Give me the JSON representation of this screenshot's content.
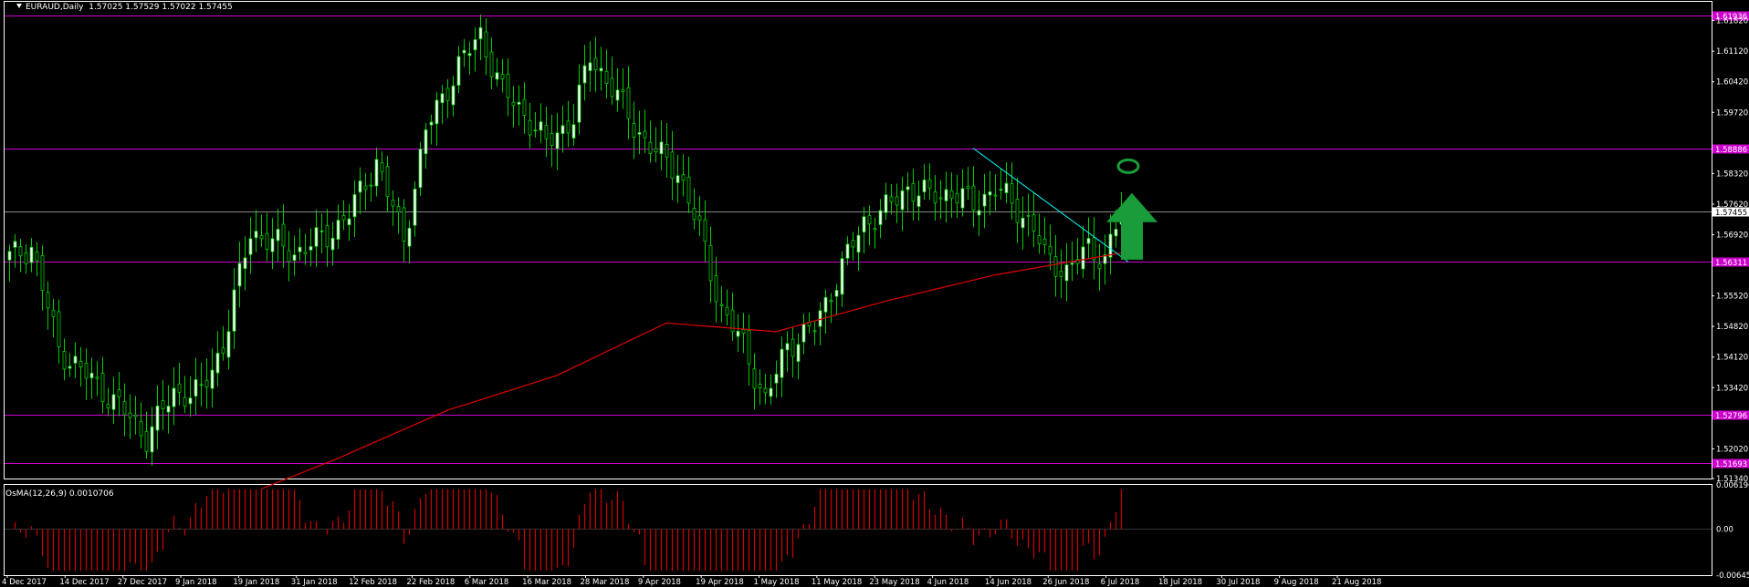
{
  "header": {
    "symbol_timeframe": "EURAUD,Daily",
    "ohlc": "1.57025 1.57529 1.57022 1.57455"
  },
  "indicator": {
    "label": "OsMA(12,26,9) 0.0010706",
    "ylim": [
      -0.00645,
      0.00619
    ],
    "tick_labels": [
      "0.006196",
      "0.00",
      "-0.006457"
    ]
  },
  "colors": {
    "background": "#000000",
    "frame": "#ffffff",
    "bull_candle": "#ffffff",
    "bear_candle": "#000000",
    "wick": "#00cc00",
    "support_resistance_lines": "#cc00cc",
    "level_label_bg": "#cc00cc",
    "moving_average": "#e00000",
    "trendline": "#00ffff",
    "current_price_line": "#8a8a8a",
    "osma_bars": "#d00000",
    "arrow": "#1a9c3a",
    "target_ellipse": "#1a9c3a"
  },
  "price_axis": {
    "ylim": [
      1.5134,
      1.6225
    ],
    "tick_labels": [
      "1.61820",
      "1.61120",
      "1.60420",
      "1.59720",
      "1.58320",
      "1.57620",
      "1.56920",
      "1.55520",
      "1.54820",
      "1.54120",
      "1.53420",
      "1.52020",
      "1.51340"
    ],
    "current_price_label": "1.57455",
    "current_price": 1.57455
  },
  "horizontal_levels": [
    {
      "label": "1.61936",
      "value": 1.61936
    },
    {
      "label": "1.58886",
      "value": 1.58886
    },
    {
      "label": "1.56311",
      "value": 1.56311
    },
    {
      "label": "1.52796",
      "value": 1.52796
    },
    {
      "label": "1.51693",
      "value": 1.51693
    }
  ],
  "time_axis": {
    "labels": [
      "4 Dec 2017",
      "14 Dec 2017",
      "27 Dec 2017",
      "9 Jan 2018",
      "19 Jan 2018",
      "31 Jan 2018",
      "12 Feb 2018",
      "22 Feb 2018",
      "6 Mar 2018",
      "16 Mar 2018",
      "28 Mar 2018",
      "9 Apr 2018",
      "19 Apr 2018",
      "1 May 2018",
      "11 May 2018",
      "23 May 2018",
      "4 Jun 2018",
      "14 Jun 2018",
      "26 Jun 2018",
      "6 Jul 2018",
      "18 Jul 2018",
      "30 Jul 2018",
      "9 Aug 2018",
      "21 Aug 2018"
    ]
  },
  "chart_data": {
    "type": "candlestick",
    "symbol": "EURAUD",
    "timeframe": "Daily",
    "ylim": [
      1.5134,
      1.6225
    ],
    "grid": false,
    "anchors": [
      {
        "i": 0,
        "close": 1.564
      },
      {
        "i": 4,
        "close": 1.5665
      },
      {
        "i": 9,
        "close": 1.543
      },
      {
        "i": 20,
        "close": 1.53
      },
      {
        "i": 25,
        "close": 1.523
      },
      {
        "i": 30,
        "close": 1.533
      },
      {
        "i": 35,
        "close": 1.533
      },
      {
        "i": 39,
        "close": 1.544
      },
      {
        "i": 44,
        "close": 1.57
      },
      {
        "i": 52,
        "close": 1.565
      },
      {
        "i": 58,
        "close": 1.569
      },
      {
        "i": 62,
        "close": 1.574
      },
      {
        "i": 67,
        "close": 1.586
      },
      {
        "i": 72,
        "close": 1.568
      },
      {
        "i": 76,
        "close": 1.593
      },
      {
        "i": 82,
        "close": 1.608
      },
      {
        "i": 86,
        "close": 1.615
      },
      {
        "i": 90,
        "close": 1.602
      },
      {
        "i": 94,
        "close": 1.597
      },
      {
        "i": 98,
        "close": 1.59
      },
      {
        "i": 103,
        "close": 1.596
      },
      {
        "i": 106,
        "close": 1.61
      },
      {
        "i": 110,
        "close": 1.603
      },
      {
        "i": 114,
        "close": 1.594
      },
      {
        "i": 118,
        "close": 1.588
      },
      {
        "i": 122,
        "close": 1.584
      },
      {
        "i": 126,
        "close": 1.57
      },
      {
        "i": 130,
        "close": 1.552
      },
      {
        "i": 134,
        "close": 1.544
      },
      {
        "i": 138,
        "close": 1.531
      },
      {
        "i": 142,
        "close": 1.544
      },
      {
        "i": 147,
        "close": 1.548
      },
      {
        "i": 152,
        "close": 1.562
      },
      {
        "i": 156,
        "close": 1.572
      },
      {
        "i": 160,
        "close": 1.575
      },
      {
        "i": 164,
        "close": 1.58
      },
      {
        "i": 168,
        "close": 1.578
      },
      {
        "i": 172,
        "close": 1.579
      },
      {
        "i": 176,
        "close": 1.576
      },
      {
        "i": 180,
        "close": 1.58
      },
      {
        "i": 184,
        "close": 1.575
      },
      {
        "i": 187,
        "close": 1.571
      },
      {
        "i": 189,
        "close": 1.564
      },
      {
        "i": 193,
        "close": 1.561
      },
      {
        "i": 197,
        "close": 1.566
      },
      {
        "i": 200,
        "close": 1.564
      },
      {
        "i": 203,
        "close": 1.5745
      }
    ],
    "moving_average": {
      "anchors": [
        {
          "i": 46,
          "value": 1.511
        },
        {
          "i": 60,
          "value": 1.518
        },
        {
          "i": 80,
          "value": 1.529
        },
        {
          "i": 100,
          "value": 1.537
        },
        {
          "i": 120,
          "value": 1.549
        },
        {
          "i": 140,
          "value": 1.547
        },
        {
          "i": 160,
          "value": 1.554
        },
        {
          "i": 180,
          "value": 1.56
        },
        {
          "i": 203,
          "value": 1.565
        }
      ]
    },
    "trendline": {
      "start": {
        "i": 176,
        "value": 1.589
      },
      "end": {
        "i": 203,
        "value": 1.563
      }
    },
    "target_ellipse": {
      "i": 202,
      "value": 1.5855
    },
    "arrow": {
      "i": 201,
      "base": 1.5635,
      "tip": 1.575,
      "direction": "up"
    }
  }
}
